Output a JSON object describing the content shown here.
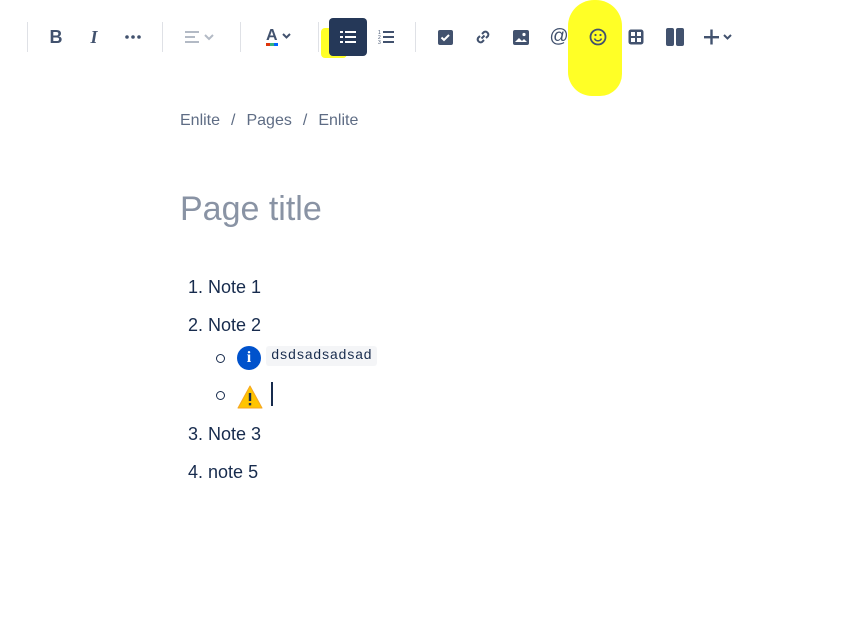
{
  "toolbar": {
    "buttons": [
      {
        "name": "bold-button",
        "label": "B"
      },
      {
        "name": "italic-button",
        "label": "I"
      },
      {
        "name": "more-formatting-button",
        "label": "···"
      },
      {
        "name": "alignment-button",
        "label": "Align"
      },
      {
        "name": "text-color-button",
        "label": "A"
      },
      {
        "name": "bullet-list-button",
        "label": "Bullet list",
        "active": true
      },
      {
        "name": "numbered-list-button",
        "label": "Numbered list"
      },
      {
        "name": "action-item-button",
        "label": "Action item"
      },
      {
        "name": "link-button",
        "label": "Link"
      },
      {
        "name": "image-button",
        "label": "Image"
      },
      {
        "name": "mention-button",
        "label": "@"
      },
      {
        "name": "emoji-button",
        "label": "Emoji"
      },
      {
        "name": "table-button",
        "label": "Table"
      },
      {
        "name": "layouts-button",
        "label": "Layouts"
      },
      {
        "name": "insert-button",
        "label": "+"
      }
    ],
    "highlight_color": "#ffff00",
    "active_color": "#253858"
  },
  "breadcrumb": {
    "items": [
      "Enlite",
      "Pages",
      "Enlite"
    ],
    "separator": "/"
  },
  "page": {
    "title_placeholder": "Page title"
  },
  "list": {
    "items": [
      {
        "number": "1.",
        "text": "Note 1"
      },
      {
        "number": "2.",
        "text": "Note 2"
      },
      {
        "number": "3.",
        "text": "Note 3"
      },
      {
        "number": "4.",
        "text": "note 5"
      }
    ],
    "sub_items": [
      {
        "icon": "info-icon",
        "code": "dsdsadsadsad"
      },
      {
        "icon": "warning-icon",
        "code": ""
      }
    ]
  }
}
